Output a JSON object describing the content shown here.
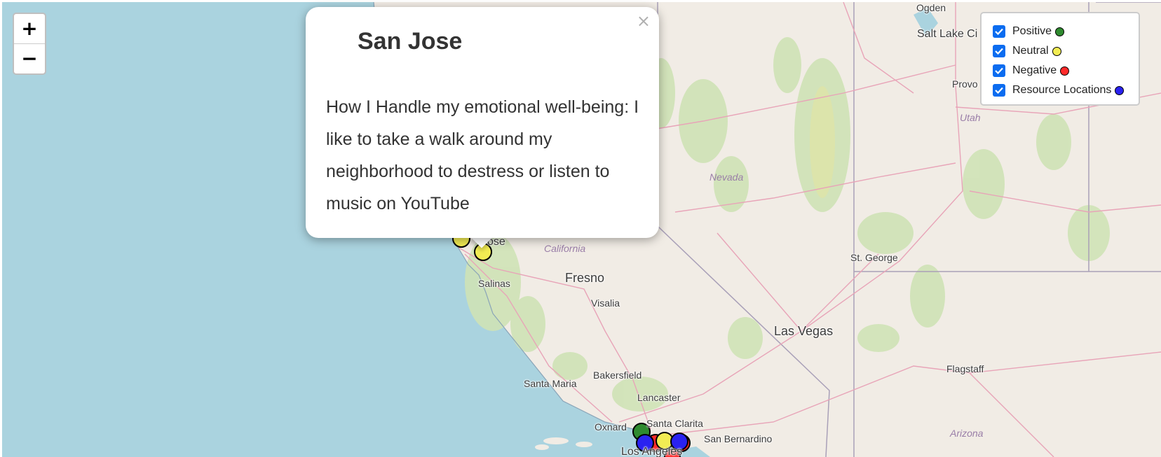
{
  "zoom": {
    "in_label": "+",
    "out_label": "−"
  },
  "legend": {
    "items": [
      {
        "label": "Positive",
        "color": "#2f8a2f",
        "checked": true
      },
      {
        "label": "Neutral",
        "color": "#f2ec53",
        "checked": true
      },
      {
        "label": "Negative",
        "color": "#ff2a2a",
        "checked": true
      },
      {
        "label": "Resource Locations",
        "color": "#2a22f0",
        "checked": true
      }
    ]
  },
  "popup": {
    "title": "San Jose",
    "body": "How I Handle my emotional well-being: I like to take a walk around my neighborhood to destress or listen to music on YouTube",
    "close_label": "×"
  },
  "map": {
    "cities": [
      "Ogden",
      "Salt Lake City",
      "Provo",
      "St. George",
      "Las Vegas",
      "Flagstaff",
      "Fresno",
      "Visalia",
      "Salinas",
      "San Jose",
      "Bakersfield",
      "Santa Maria",
      "Lancaster",
      "Santa Clarita",
      "Oxnard",
      "San Bernardino",
      "Los Angeles"
    ],
    "states": [
      "Utah",
      "Nevada",
      "California",
      "Arizona"
    ],
    "city_labels": {
      "ogden": "Ogden",
      "slc": "Salt Lake Ci",
      "provo": "Provo",
      "st_george": "St. George",
      "las_vegas": "Las Vegas",
      "flagstaff": "Flagstaff",
      "fresno": "Fresno",
      "visalia": "Visalia",
      "salinas": "Salinas",
      "san_jose": "ose",
      "bakersfield": "Bakersfield",
      "santa_maria": "Santa Maria",
      "lancaster": "Lancaster",
      "santa_clarita": "Santa Clarita",
      "oxnard": "Oxnard",
      "san_bernardino": "San Bernardino",
      "los_angeles": "Los Angeles"
    },
    "state_labels": {
      "utah": "Utah",
      "nevada": "Nevada",
      "california": "California",
      "arizona": "Arizona"
    }
  }
}
